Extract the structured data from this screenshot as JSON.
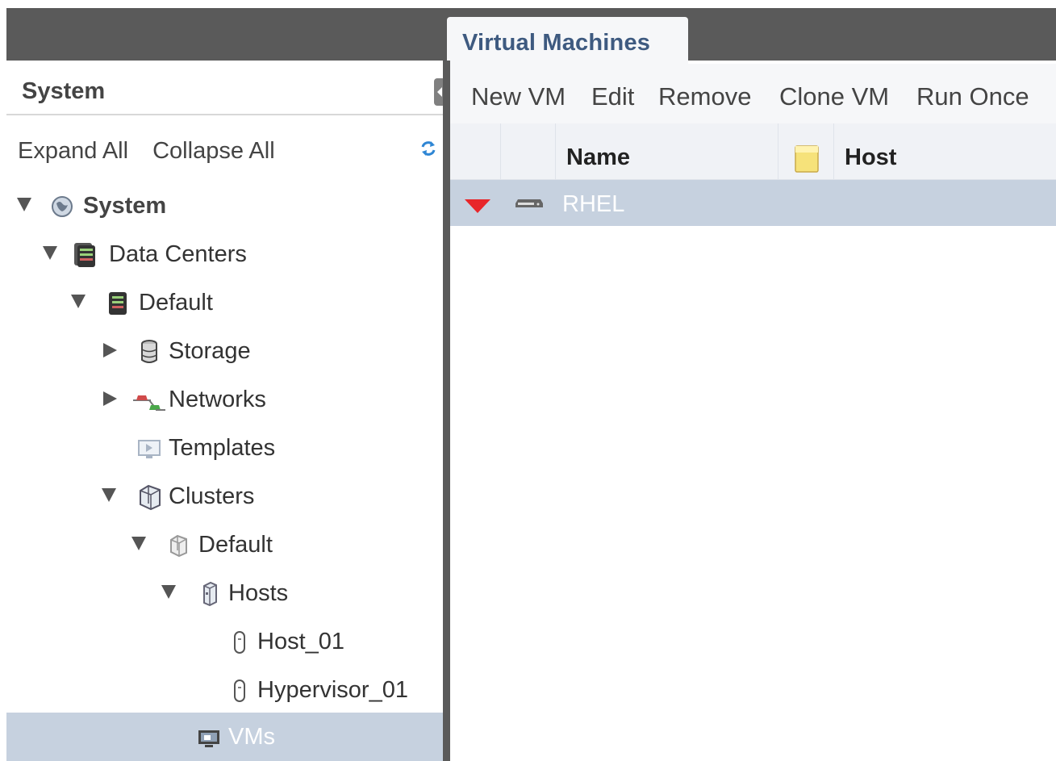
{
  "main_tab": {
    "label": "Virtual Machines"
  },
  "left_panel": {
    "title": "System",
    "actions": {
      "expand_all": "Expand All",
      "collapse_all": "Collapse All"
    },
    "tree": [
      {
        "label": "System",
        "icon": "globe-icon",
        "expanded": true,
        "bold": true
      },
      {
        "label": "Data Centers",
        "icon": "datacenters-icon",
        "expanded": true
      },
      {
        "label": "Default",
        "icon": "datacenter-icon",
        "expanded": true
      },
      {
        "label": "Storage",
        "icon": "storage-icon",
        "expanded": false
      },
      {
        "label": "Networks",
        "icon": "network-icon",
        "expanded": false
      },
      {
        "label": "Templates",
        "icon": "template-icon"
      },
      {
        "label": "Clusters",
        "icon": "clusters-icon",
        "expanded": true
      },
      {
        "label": "Default",
        "icon": "cluster-icon",
        "expanded": true
      },
      {
        "label": "Hosts",
        "icon": "hosts-icon",
        "expanded": true
      },
      {
        "label": "Host_01",
        "icon": "host-icon"
      },
      {
        "label": "Hypervisor_01",
        "icon": "host-icon"
      },
      {
        "label": "VMs",
        "icon": "vms-icon",
        "selected": true
      }
    ]
  },
  "toolbar": {
    "new_vm": "New VM",
    "edit": "Edit",
    "remove": "Remove",
    "clone_vm": "Clone VM",
    "run_once": "Run Once"
  },
  "grid": {
    "columns": {
      "name": "Name",
      "host": "Host"
    },
    "rows": [
      {
        "name": "RHEL",
        "status": "down"
      }
    ]
  },
  "colors": {
    "topbar": "#5a5a5a",
    "selection": "#c6d1df",
    "tab_text": "#3e5a80",
    "status_down": "#e8262a"
  }
}
